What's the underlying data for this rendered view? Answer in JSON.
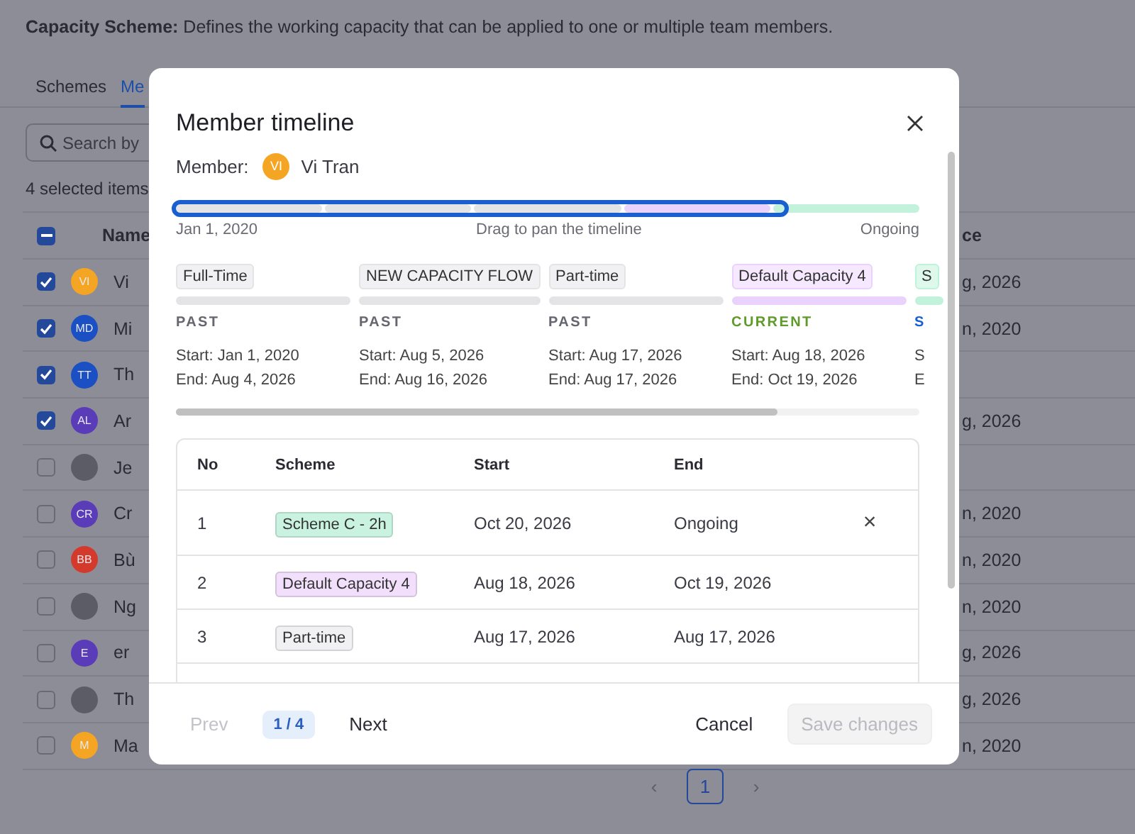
{
  "page": {
    "heading_bold": "Capacity Scheme:",
    "heading_text": "Defines the working capacity that can be applied to one or multiple team members.",
    "tabs": [
      {
        "label": "Schemes",
        "selected": false
      },
      {
        "label": "Me",
        "selected": true
      }
    ],
    "search": {
      "placeholder": "Search by"
    },
    "selection_count": "4 selected items",
    "table": {
      "select_all": {
        "checked": true
      },
      "columns": [
        "Name",
        "ce"
      ],
      "rows": [
        {
          "checked": true,
          "avatar": {
            "kind": "initials",
            "text": "VI",
            "color": "#f5a524"
          },
          "name": "Vi",
          "last": "g, 2026"
        },
        {
          "checked": true,
          "avatar": {
            "kind": "initials",
            "text": "MD",
            "color": "#1b4fc4"
          },
          "name": "Mi",
          "last": "n, 2020"
        },
        {
          "checked": true,
          "avatar": {
            "kind": "initials",
            "text": "TT",
            "color": "#1b4fc4"
          },
          "name": "Th"
        },
        {
          "checked": true,
          "avatar": {
            "kind": "initials",
            "text": "AL",
            "color": "#5a3bb8"
          },
          "name": "Ar",
          "last": "g, 2026"
        },
        {
          "checked": false,
          "avatar": {
            "kind": "photo"
          },
          "name": "Je"
        },
        {
          "checked": false,
          "avatar": {
            "kind": "initials",
            "text": "CR",
            "color": "#5a3bb8"
          },
          "name": "Cr",
          "last": "n, 2020"
        },
        {
          "checked": false,
          "avatar": {
            "kind": "initials",
            "text": "BB",
            "color": "#d33a2c"
          },
          "name": "Bù",
          "last": "n, 2020"
        },
        {
          "checked": false,
          "avatar": {
            "kind": "photo"
          },
          "name": "Ng",
          "last": "n, 2020"
        },
        {
          "checked": false,
          "avatar": {
            "kind": "initials",
            "text": "E",
            "color": "#5a3bb8"
          },
          "name": "er",
          "last": "g, 2026"
        },
        {
          "checked": false,
          "avatar": {
            "kind": "photo"
          },
          "name": "Th",
          "last": "g, 2026"
        },
        {
          "checked": false,
          "avatar": {
            "kind": "initials",
            "text": "M",
            "color": "#f5a524"
          },
          "name": "Ma",
          "last": "n, 2020"
        }
      ]
    },
    "pagination": {
      "prev": "‹",
      "pages": [
        {
          "label": "1",
          "selected": true
        }
      ],
      "next": "›"
    }
  },
  "modal": {
    "title": "Member timeline",
    "member_label": "Member:",
    "member": {
      "initials": "VI",
      "color": "#f5a524",
      "name": "Vi Tran"
    },
    "timeline": {
      "start": "Jan 1, 2020",
      "hint": "Drag to pan the timeline",
      "end": "Ongoing",
      "segments": [
        {
          "color": "#e4e4e7"
        },
        {
          "color": "#e4e4e7"
        },
        {
          "color": "#e4e4e7"
        },
        {
          "color": "#e9d2fb"
        },
        {
          "color": "#c2f1dc"
        }
      ]
    },
    "periods": [
      {
        "scheme": "Full-Time",
        "color": "#e4e4e7",
        "status": "PAST",
        "kind": "past",
        "start": "Start: Jan 1, 2020",
        "end": "End: Aug 4, 2026"
      },
      {
        "scheme": "NEW CAPACITY FLOW",
        "color": "#e4e4e7",
        "status": "PAST",
        "kind": "past",
        "start": "Start: Aug 5, 2026",
        "end": "End: Aug 16, 2026"
      },
      {
        "scheme": "Part-time",
        "color": "#e4e4e7",
        "status": "PAST",
        "kind": "past",
        "start": "Start: Aug 17, 2026",
        "end": "End: Aug 17, 2026"
      },
      {
        "scheme": "Default Capacity 4",
        "color": "#e9d2fb",
        "status": "CURRENT",
        "kind": "current",
        "start": "Start: Aug 18, 2026",
        "end": "End: Oct 19, 2026"
      },
      {
        "scheme": "S",
        "color": "#c2f1dc",
        "status": "S",
        "kind": "scheduled",
        "start": "S",
        "end": "E"
      }
    ],
    "table": {
      "columns": [
        "No",
        "Scheme",
        "Start",
        "End"
      ],
      "rows": [
        {
          "no": "1",
          "scheme": "Scheme C - 2h",
          "color": "#c9f3e0",
          "start": "Oct 20, 2026",
          "end": "Ongoing",
          "remove": "×"
        },
        {
          "no": "2",
          "scheme": "Default Capacity 4",
          "color": "#f1dffc",
          "start": "Aug 18, 2026",
          "end": "Oct 19, 2026"
        },
        {
          "no": "3",
          "scheme": "Part-time",
          "color": "#f1f1f3",
          "start": "Aug 17, 2026",
          "end": "Aug 17, 2026"
        }
      ]
    },
    "footer": {
      "prev": {
        "label": "Prev",
        "disabled": true
      },
      "page": "1 / 4",
      "next": {
        "label": "Next",
        "disabled": false
      },
      "cancel": "Cancel",
      "save": {
        "label": "Save changes",
        "disabled": true
      }
    }
  }
}
